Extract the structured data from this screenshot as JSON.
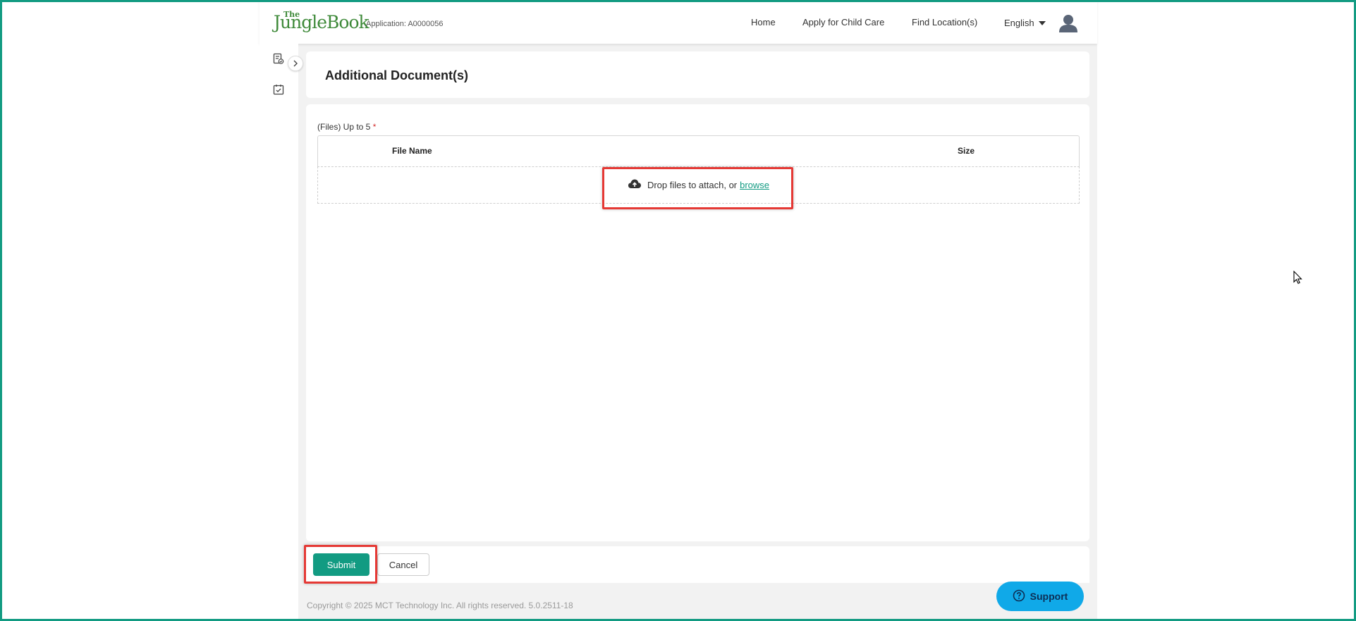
{
  "header": {
    "logo_small": "The",
    "logo_main": "JungleBook",
    "application_id": "Application: A0000056",
    "nav": [
      "Home",
      "Apply for Child Care",
      "Find Location(s)"
    ],
    "language": "English"
  },
  "icons": {
    "rail_top": "document-check-icon",
    "rail_second": "calendar-check-icon",
    "rail_toggle": "chevron-right-icon",
    "user": "user-avatar-icon",
    "upload": "cloud-upload-icon",
    "support": "help-circle-icon"
  },
  "page": {
    "title": "Additional Document(s)",
    "files_label": "(Files) Up to 5",
    "required_mark": "*",
    "columns": [
      "File Name",
      "Size"
    ],
    "drop_text": "Drop files to attach, or",
    "browse": "browse"
  },
  "actions": {
    "submit": "Submit",
    "cancel": "Cancel"
  },
  "footer": {
    "copyright": "Copyright © 2025 MCT Technology Inc. All rights reserved. 5.0.2511-18",
    "support": "Support"
  },
  "colors": {
    "accent": "#129b82",
    "support": "#10a9e8",
    "highlight": "#e53935"
  }
}
